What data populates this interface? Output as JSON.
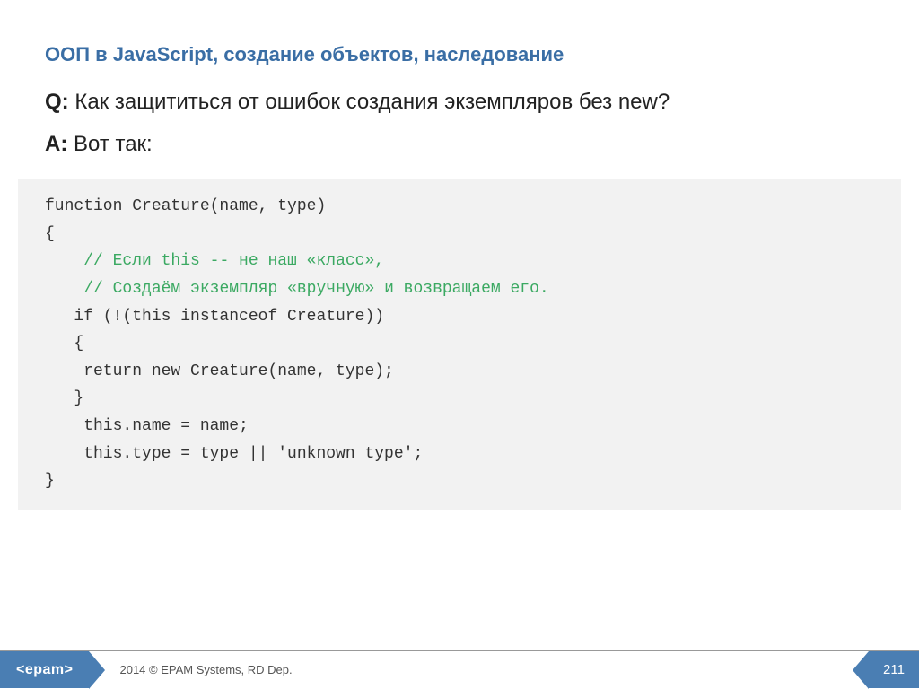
{
  "title": "ООП в JavaScript, создание объектов, наследование",
  "question": {
    "label": "Q:",
    "text": "Как защититься от ошибок создания экземпляров без new?"
  },
  "answer": {
    "label": "A:",
    "text": "Вот так:"
  },
  "code": {
    "l1": "function Creature(name, type)",
    "l2": "{",
    "l3_indent": "    ",
    "l3": "// Если this -- не наш «класс»,",
    "l4_indent": "    ",
    "l4": "// Создаём экземпляр «вручную» и возвращаем его.",
    "l5": "   if (!(this instanceof Creature))",
    "l6": "   {",
    "l7": "    return new Creature(name, type);",
    "l8": "   }",
    "l9": "",
    "l10": "    this.name = name;",
    "l11": "    this.type = type || 'unknown type';",
    "l12": "}"
  },
  "footer": {
    "logo": "<epam>",
    "text": "2014 © EPAM Systems, RD Dep.",
    "page": "211"
  }
}
